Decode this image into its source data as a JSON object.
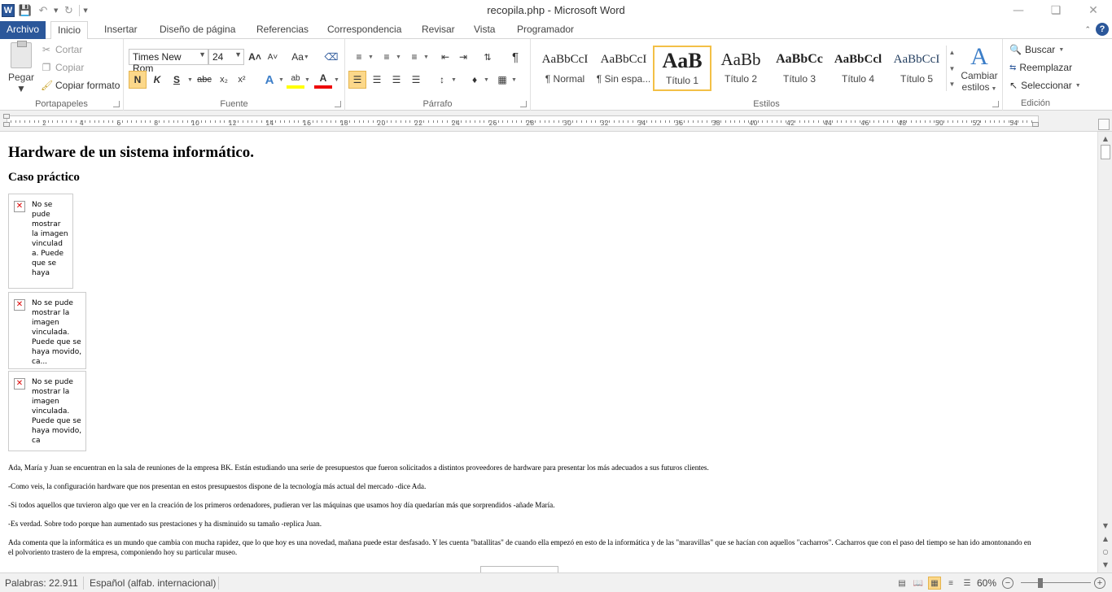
{
  "window": {
    "title": "recopila.php  -  Microsoft Word"
  },
  "tabs": [
    "Archivo",
    "Inicio",
    "Insertar",
    "Diseño de página",
    "Referencias",
    "Correspondencia",
    "Revisar",
    "Vista",
    "Programador"
  ],
  "clipboard": {
    "paste": "Pegar",
    "cut": "Cortar",
    "copy": "Copiar",
    "format_painter": "Copiar formato",
    "label": "Portapapeles"
  },
  "font": {
    "name": "Times New Rom",
    "size": "24",
    "label": "Fuente",
    "grow": "A˄",
    "shrink": "A˅",
    "case": "Aa",
    "bold": "N",
    "italic": "K",
    "underline": "S",
    "strike": "abc",
    "subscript": "x₂",
    "superscript": "x²",
    "color": "A"
  },
  "paragraph": {
    "label": "Párrafo",
    "pilcrow": "¶"
  },
  "styles": {
    "label": "Estilos",
    "items": [
      {
        "sample": "AaBbCcI",
        "name": "¶ Normal"
      },
      {
        "sample": "AaBbCcI",
        "name": "¶ Sin espa..."
      },
      {
        "sample": "AaB",
        "name": "Título 1"
      },
      {
        "sample": "AaBb",
        "name": "Título 2"
      },
      {
        "sample": "AaBbCc",
        "name": "Título 3"
      },
      {
        "sample": "AaBbCcl",
        "name": "Título 4"
      },
      {
        "sample": "AaBbCcI",
        "name": "Título 5"
      }
    ],
    "change": "Cambiar",
    "change2": "estilos"
  },
  "editing": {
    "label": "Edición",
    "find": "Buscar",
    "replace": "Reemplazar",
    "select": "Seleccionar"
  },
  "ruler": {
    "numbers": [
      "2",
      "4",
      "6",
      "8",
      "10",
      "12",
      "14",
      "16",
      "18",
      "20",
      "22",
      "24",
      "26",
      "28",
      "30",
      "32",
      "34",
      "36",
      "38",
      "40",
      "42",
      "44",
      "46",
      "48",
      "50",
      "52",
      "54"
    ]
  },
  "document": {
    "heading": "Hardware de un sistema informático.",
    "subheading": "Caso práctico",
    "broken_images": [
      "No se pude mostrar la imagen vinculad a. Puede que se haya",
      "No se pude mostrar la imagen vinculada. Puede que se haya movido, ca...",
      "No se pude mostrar la imagen vinculada. Puede que se haya movido, ca"
    ],
    "paragraphs": [
      "Ada, María y Juan se encuentran en la sala de reuniones de la empresa BK. Están estudiando una serie de presupuestos que fueron solicitados a distintos proveedores de hardware para presentar los más adecuados a sus futuros clientes.",
      "-Como veis, la configuración hardware que nos presentan en estos presupuestos dispone de la tecnología más actual del mercado -dice Ada.",
      "-Si todos aquellos que tuvieron algo que ver en la creación de los primeros ordenadores, pudieran ver las máquinas que usamos hoy día quedarían más que sorprendidos -añade María.",
      "-Es verdad. Sobre todo porque han aumentado sus prestaciones y ha disminuido su tamaño -replica Juan.",
      "Ada comenta que la informática es un mundo que cambia con mucha rapidez, que lo que hoy es una novedad, mañana puede estar desfasado. Y les cuenta \"batallitas\" de cuando ella empezó en esto de la informática y de las \"maravillas\" que se hacían con aquellos \"cacharros\". Cacharros que con el paso del tiempo se han ido amontonando en el polvoriento trastero de la empresa, componiendo hoy su particular museo."
    ]
  },
  "status": {
    "words": "Palabras: 22.911",
    "language": "Español (alfab. internacional)",
    "zoom": "60%",
    "zoom_level": 0.6
  }
}
